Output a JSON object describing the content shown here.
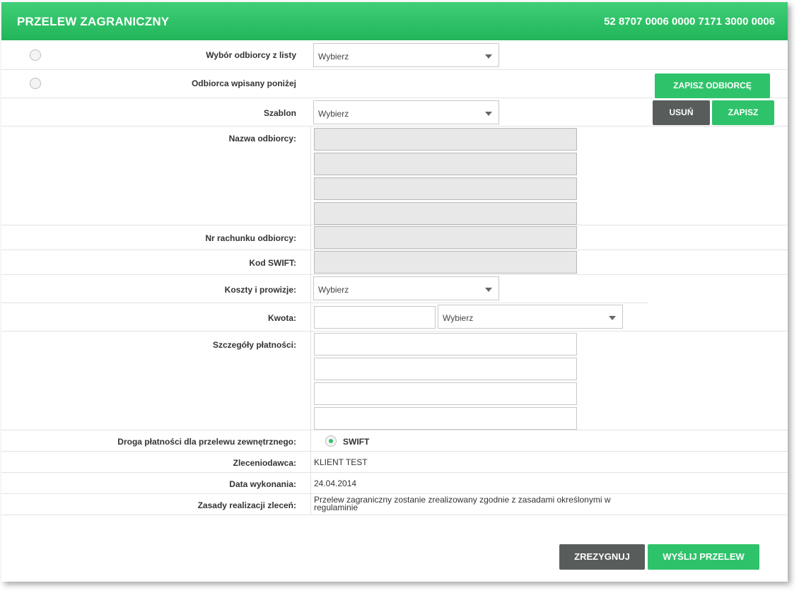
{
  "header": {
    "title": "PRZELEW ZAGRANICZNY",
    "account": "52 8707 0006 0000 7171 3000 0006"
  },
  "recipient": {
    "from_list_label": "Wybór odbiorcy z listy",
    "from_list_select": "Wybierz",
    "manual_label": "Odbiorca wpisany poniżej",
    "save_recipient_button": "ZAPISZ ODBIORCĘ"
  },
  "template": {
    "label": "Szablon",
    "select": "Wybierz",
    "delete_button": "USUŃ",
    "save_button": "ZAPISZ"
  },
  "fields": {
    "recipient_name_label": "Nazwa odbiorcy:",
    "account_number_label": "Nr rachunku odbiorcy:",
    "swift_code_label": "Kod SWIFT:",
    "costs_label": "Koszty i prowizje:",
    "costs_select": "Wybierz",
    "amount_label": "Kwota:",
    "currency_select": "Wybierz",
    "details_label": "Szczegóły płatności:",
    "payment_route_label": "Droga płatności dla przelewu zewnętrznego:",
    "payment_route_option": "SWIFT",
    "orderer_label": "Zleceniodawca:",
    "orderer_value": "KLIENT TEST",
    "execution_date_label": "Data wykonania:",
    "execution_date_value": "24.04.2014",
    "rules_label": "Zasady realizacji zleceń:",
    "rules_value": "Przelew zagraniczny zostanie zrealizowany zgodnie z zasadami określonymi w regulaminie"
  },
  "actions": {
    "cancel_button": "ZREZYGNUJ",
    "send_button": "WYŚLIJ PRZELEW"
  },
  "colors": {
    "accent": "#2ec36a",
    "dark_button": "#585d5b"
  }
}
